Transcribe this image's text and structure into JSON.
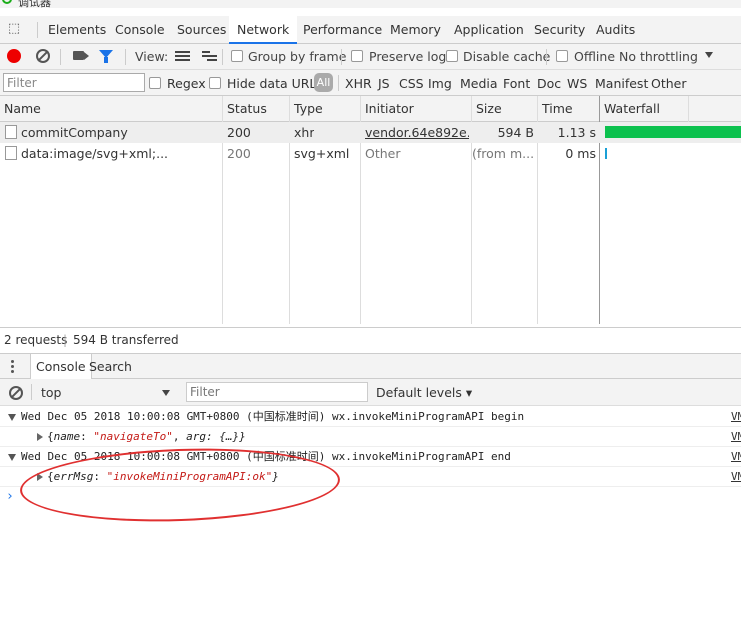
{
  "window": {
    "title": "调试器"
  },
  "tabs": [
    "Elements",
    "Console",
    "Sources",
    "Network",
    "Performance",
    "Memory",
    "Application",
    "Security",
    "Audits"
  ],
  "toolbar": {
    "view_label": "View:",
    "group_by_frame": "Group by frame",
    "preserve_log": "Preserve log",
    "disable_cache": "Disable cache",
    "offline": "Offline",
    "throttling": "No throttling"
  },
  "filterbar": {
    "placeholder": "Filter",
    "regex": "Regex",
    "hide_data_urls": "Hide data URLs",
    "all": "All",
    "types": [
      "XHR",
      "JS",
      "CSS",
      "Img",
      "Media",
      "Font",
      "Doc",
      "WS",
      "Manifest",
      "Other"
    ]
  },
  "columns": [
    "Name",
    "Status",
    "Type",
    "Initiator",
    "Size",
    "Time",
    "Waterfall"
  ],
  "requests": [
    {
      "name": "commitCompany",
      "status": "200",
      "type": "xhr",
      "initiator": "vendor.64e892e...",
      "size": "594 B",
      "time": "1.13 s"
    },
    {
      "name": "data:image/svg+xml;...",
      "status": "200",
      "type": "svg+xml",
      "initiator": "Other",
      "size": "(from m...",
      "time": "0 ms"
    }
  ],
  "summary": {
    "requests": "2 requests",
    "transferred": "594 B transferred"
  },
  "drawer": {
    "tabs": [
      "Console",
      "Search"
    ]
  },
  "console_toolbar": {
    "context": "top",
    "filter_placeholder": "Filter",
    "levels": "Default levels"
  },
  "console_messages": [
    {
      "text": "Wed Dec 05 2018 10:00:08 GMT+0800 (中国标准时间) wx.invokeMiniProgramAPI begin",
      "src": "VM"
    },
    {
      "obj_prefix": "{",
      "k1": "name",
      "sep1": ": ",
      "v1": "\"navigateTo\"",
      "sep2": ", ",
      "k2": "arg",
      "rest": ": {…}}",
      "src": "VM"
    },
    {
      "text": "Wed Dec 05 2018 10:00:08 GMT+0800 (中国标准时间) wx.invokeMiniProgramAPI end",
      "src": "VM"
    },
    {
      "obj_prefix": "{",
      "k1": "errMsg",
      "sep1": ": ",
      "v1": "\"invokeMiniProgramAPI:ok\"",
      "rest": "}",
      "src": "VM"
    }
  ],
  "colors": {
    "accent": "#1a73e8",
    "record": "#ee0000",
    "waterfall": "#0cc14e",
    "annotation": "#e03030"
  }
}
